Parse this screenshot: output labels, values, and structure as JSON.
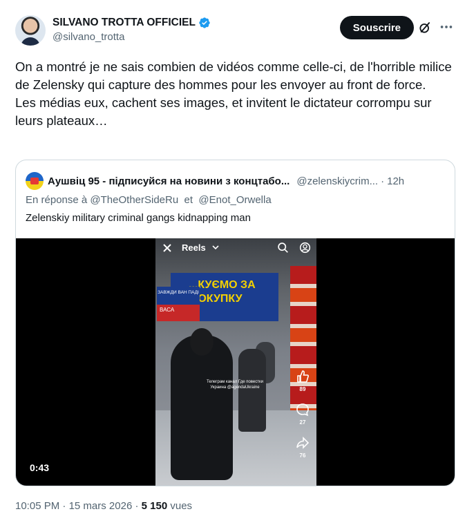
{
  "author": {
    "name": "SILVANO TROTTA OFFICIEL",
    "handle": "@silvano_trotta",
    "avatar_icon": "avatar-photo",
    "verified_icon": "verified-badge-icon"
  },
  "actions": {
    "subscribe_label": "Souscrire",
    "grok_icon": "grok-icon",
    "more_icon": "more-icon"
  },
  "tweet": {
    "text_line1": "On a montré je ne sais combien de vidéos comme celle-ci, de l'horrible milice de Zelensky qui capture des hommes pour les envoyer au front de force.",
    "text_line2": "Les médias eux, cachent ses images, et invitent le dictateur corrompu sur leurs plateaux…"
  },
  "quote": {
    "name": "Аушвіц 95 - підписуйся на новини з концтабо...",
    "handle": "@zelenskiycrim...",
    "dot": "·",
    "time": "12h",
    "reply_prefix": "En réponse à",
    "reply_mention1": "@TheOtherSideRu",
    "reply_joiner": "et",
    "reply_mention2": "@Enot_Orwella",
    "text": "Zelenskiy military criminal gangs kidnapping man",
    "video": {
      "duration": "0:43",
      "reels_label": "Reels",
      "banner_text": "...КУЄМО ЗА ...ОКУПКУ",
      "sign_blue_text": "ЗАВЖДИ ВАН ПАДІ",
      "sign_red_text": "ВАСА",
      "watermark": "Телеграм канал Где повестки Украина @agendaUkraine",
      "likes": "89",
      "comments": "27",
      "shares": "76"
    }
  },
  "meta": {
    "time": "10:05 PM",
    "sep": " · ",
    "date": "15 mars 2026",
    "sep2": " · ",
    "views": "5 150",
    "views_label": "vues"
  },
  "colors": {
    "text_primary": "#0f1419",
    "text_secondary": "#536471",
    "border": "#cfd9de",
    "verified": "#1d9bf0"
  }
}
